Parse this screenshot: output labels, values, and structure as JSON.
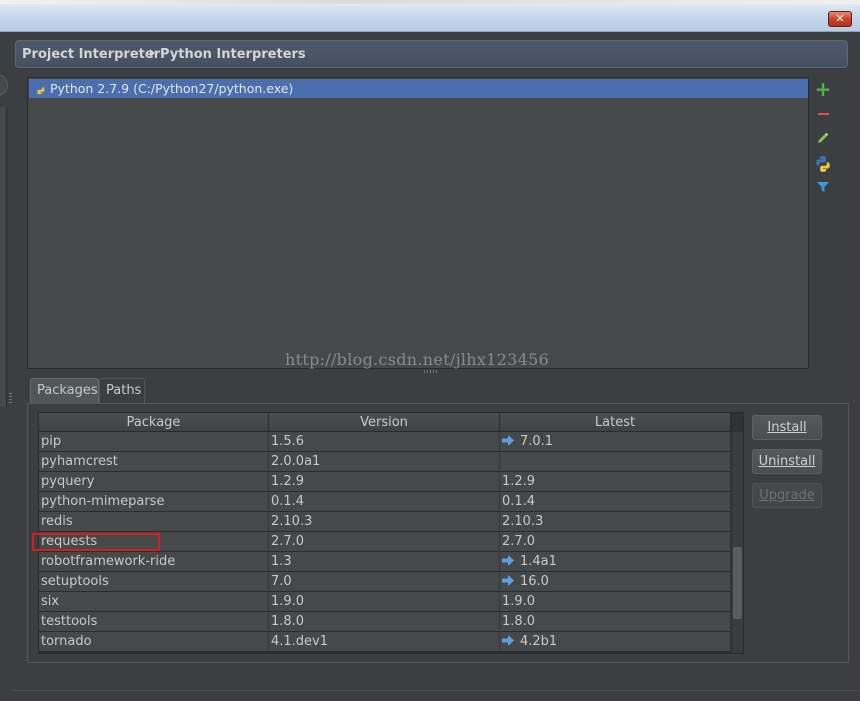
{
  "window": {
    "close_glyph": "✕"
  },
  "breadcrumb": {
    "parent": "Project Interpreter",
    "current": "Python Interpreters"
  },
  "interpreters": [
    {
      "label": "Python 2.7.9 (C:/Python27/python.exe)",
      "icon": "python-icon",
      "selected": true
    }
  ],
  "side_tools": [
    "add-icon",
    "remove-icon",
    "edit-icon",
    "python-packages-icon",
    "filter-icon"
  ],
  "watermark": "http://blog.csdn.net/jlhx123456",
  "tabs": [
    {
      "label": "Packages",
      "active": true
    },
    {
      "label": "Paths",
      "active": false
    }
  ],
  "table": {
    "columns": [
      "Package",
      "Version",
      "Latest"
    ],
    "rows": [
      {
        "package": "pip",
        "version": "1.5.6",
        "latest": "7.0.1",
        "upgrade": true
      },
      {
        "package": "pyhamcrest",
        "version": "2.0.0a1",
        "latest": "",
        "upgrade": false
      },
      {
        "package": "pyquery",
        "version": "1.2.9",
        "latest": "1.2.9",
        "upgrade": false
      },
      {
        "package": "python-mimeparse",
        "version": "0.1.4",
        "latest": "0.1.4",
        "upgrade": false
      },
      {
        "package": "redis",
        "version": "2.10.3",
        "latest": "2.10.3",
        "upgrade": false
      },
      {
        "package": "requests",
        "version": "2.7.0",
        "latest": "2.7.0",
        "upgrade": false
      },
      {
        "package": "robotframework-ride",
        "version": "1.3",
        "latest": "1.4a1",
        "upgrade": true
      },
      {
        "package": "setuptools",
        "version": "7.0",
        "latest": "16.0",
        "upgrade": true
      },
      {
        "package": "six",
        "version": "1.9.0",
        "latest": "1.9.0",
        "upgrade": false
      },
      {
        "package": "testtools",
        "version": "1.8.0",
        "latest": "1.8.0",
        "upgrade": false
      },
      {
        "package": "tornado",
        "version": "4.1.dev1",
        "latest": "4.2b1",
        "upgrade": true
      }
    ]
  },
  "buttons": {
    "install": "Install",
    "uninstall": "Uninstall",
    "upgrade": "Upgrade"
  },
  "colors": {
    "selection": "#4b6eaf",
    "annotation_box": "#d41f1f",
    "upgrade_arrow": "#5aa0e6",
    "add": "#4fb34a",
    "remove": "#d9534f"
  }
}
